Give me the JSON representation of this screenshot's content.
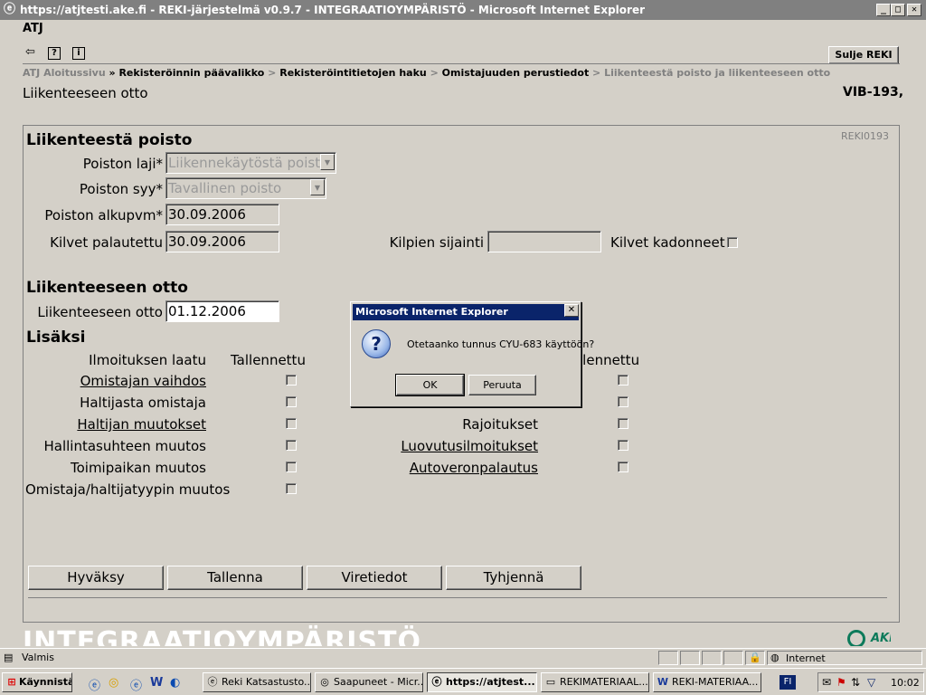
{
  "window": {
    "title": "https://atjtesti.ake.fi - REKI-järjestelmä v0.9.7 - INTEGRAATIOYMPÄRISTÖ - Microsoft Internet Explorer"
  },
  "app": {
    "name": "ATJ",
    "close_button": "Sulje REKI"
  },
  "breadcrumb": {
    "items": [
      "ATJ Aloitussivu",
      "Rekisteröinnin päävalikko",
      "Rekisteröintitietojen haku",
      "Omistajuuden perustiedot",
      "Liikenteestä poisto ja liikenteeseen otto"
    ],
    "separators": [
      "»",
      ">",
      ">",
      ">"
    ]
  },
  "page": {
    "title": "Liikenteeseen otto",
    "vehicle_id": "VIB-193,",
    "form_code": "REKI0193"
  },
  "removal": {
    "heading": "Liikenteestä poisto",
    "type_label": "Poiston laji*",
    "type_value": "Liikennekäytöstä poisto",
    "reason_label": "Poiston syy*",
    "reason_value": "Tavallinen poisto",
    "start_label": "Poiston alkupvm*",
    "start_value": "30.09.2006",
    "plates_returned_label": "Kilvet palautettu",
    "plates_returned_value": "30.09.2006",
    "plates_location_label": "Kilpien sijainti",
    "plates_location_value": "",
    "plates_lost_label": "Kilvet kadonneet"
  },
  "return_to_traffic": {
    "heading": "Liikenteeseen otto",
    "date_label": "Liikenteeseen otto",
    "date_value": "01.12.2006"
  },
  "additional": {
    "heading": "Lisäksi",
    "col_type": "Ilmoituksen laatu",
    "col_saved": "Tallennettu",
    "col_saved_right": "llennettu",
    "left_items": [
      {
        "label": "Omistajan vaihdos",
        "link": true
      },
      {
        "label": "Haltijasta omistaja",
        "link": false
      },
      {
        "label": "Haltijan muutokset",
        "link": true
      },
      {
        "label": "Hallintasuhteen muutos",
        "link": false
      },
      {
        "label": "Toimipaikan muutos",
        "link": false
      },
      {
        "label": "Omistaja/haltijatyypin muutos",
        "link": false
      }
    ],
    "right_items": [
      {
        "label": "Rajoitukset",
        "link": false
      },
      {
        "label": "Luovutusilmoitukset",
        "link": true
      },
      {
        "label": "Autoveronpalautus",
        "link": true
      }
    ]
  },
  "actions": {
    "accept": "Hyväksy",
    "save": "Tallenna",
    "error_info": "Viretiedot",
    "clear": "Tyhjennä"
  },
  "footer": {
    "environment": "INTEGRAATIOYMPÄRISTÖ",
    "logo": "AKE"
  },
  "dialog": {
    "title": "Microsoft Internet Explorer",
    "message": "Otetaanko tunnus CYU-683 käyttöön?",
    "ok": "OK",
    "cancel": "Peruuta"
  },
  "statusbar": {
    "text": "Valmis",
    "zone": "Internet"
  },
  "taskbar": {
    "start": "Käynnistä",
    "tasks": [
      "Reki Katsastusto...",
      "Saapuneet - Micr...",
      "https://atjtest...",
      "REKIMATERIAAL...",
      "REKI-MATERIAA..."
    ],
    "language": "FI",
    "clock": "10:02"
  }
}
